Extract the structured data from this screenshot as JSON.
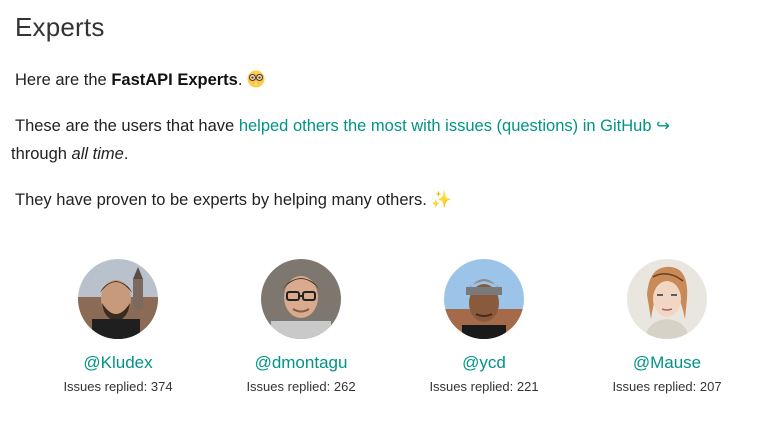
{
  "page": {
    "title": "Experts"
  },
  "intro": {
    "prefix": "Here are the ",
    "bold": "FastAPI Experts",
    "suffix": ". ",
    "emoji_icon": "nerd-face-icon"
  },
  "users": {
    "prefix": "These are the users that have ",
    "link_text": "helped others the most with issues (questions) in GitHub ↪",
    "middle": " through ",
    "italic": "all time",
    "suffix": "."
  },
  "proven": {
    "text": "They have proven to be experts by helping many others. ",
    "emoji": "✨"
  },
  "experts": [
    {
      "handle": "@Kludex",
      "count_label": "Issues replied: 374"
    },
    {
      "handle": "@dmontagu",
      "count_label": "Issues replied: 262"
    },
    {
      "handle": "@ycd",
      "count_label": "Issues replied: 221"
    },
    {
      "handle": "@Mause",
      "count_label": "Issues replied: 207"
    }
  ],
  "colors": {
    "link": "#009485",
    "text": "#222222"
  }
}
